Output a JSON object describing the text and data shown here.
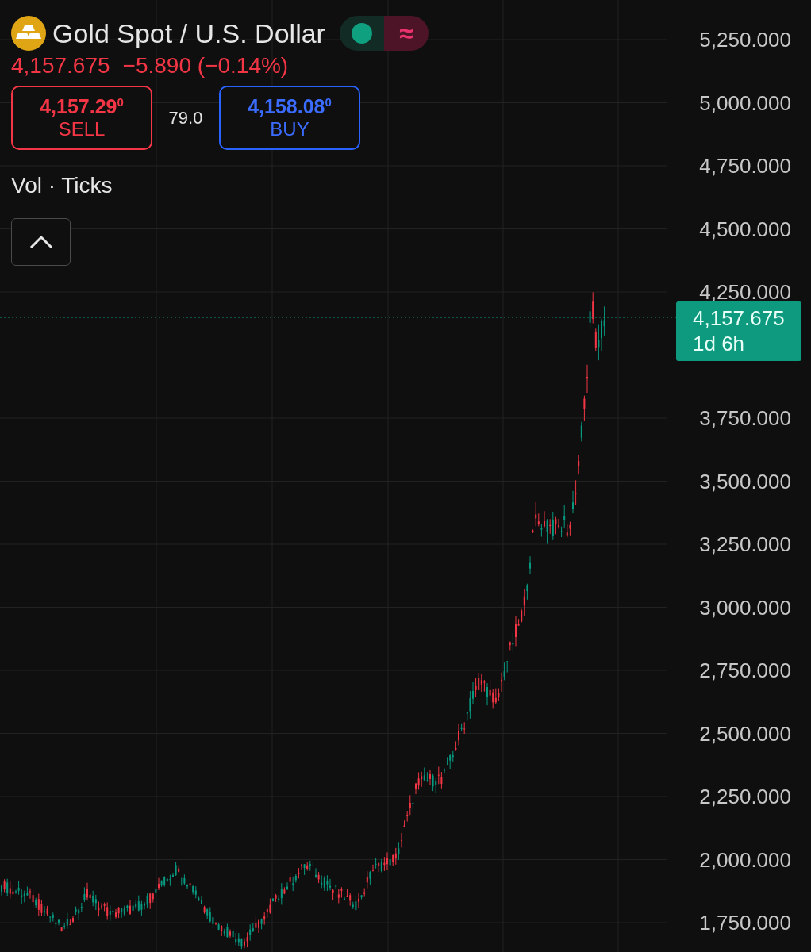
{
  "instrument": {
    "title": "Gold Spot / U.S. Dollar"
  },
  "status_toggle": {
    "symbol": "≈"
  },
  "quote": {
    "last": "4,157.675",
    "change": "−5.890 (−0.14%)"
  },
  "trade_buttons": [
    {
      "kind": "sell",
      "price": "4,157.29$^{0}$",
      "label": "SELL"
    },
    {
      "kind": "buy",
      "price": "4,158.08$^{0}$",
      "label": "BUY"
    }
  ],
  "spread": "79.0",
  "indicator": "Vol · Ticks",
  "collapse_button": {
    "expanded": true
  },
  "price_axis": {
    "upper_labels": [
      "5,250.000",
      "5,000.000",
      "4,750.000",
      "4,500.000",
      "4,250.000"
    ],
    "lower_labels": [
      "3,750.000",
      "3,500.000",
      "3,250.000",
      "3,000.000",
      "2,750.000",
      "2,500.000",
      "2,250.000",
      "2,000.000",
      "1,750.000"
    ]
  },
  "last_price_label": {
    "price": "4,157.675",
    "countdown": "1d 6h"
  }
}
